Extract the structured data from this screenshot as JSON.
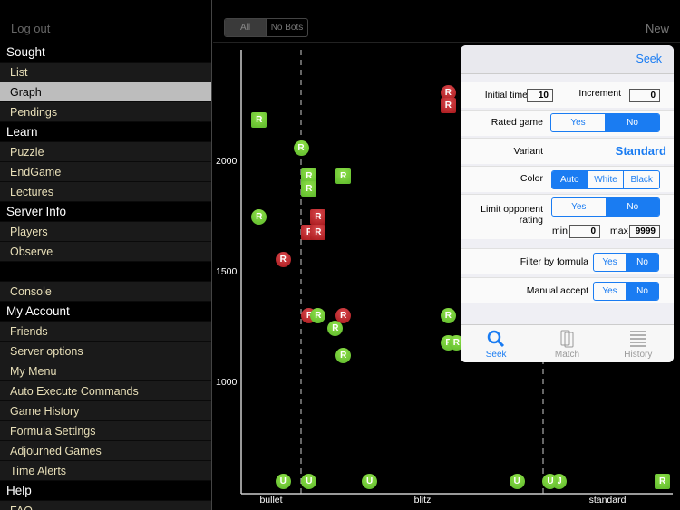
{
  "sidebar": {
    "logout": "Log out",
    "rows": [
      {
        "label": "Sought",
        "type": "header"
      },
      {
        "label": "List",
        "type": "item"
      },
      {
        "label": "Graph",
        "type": "item",
        "selected": true
      },
      {
        "label": "Pendings",
        "type": "item"
      },
      {
        "label": "Learn",
        "type": "header"
      },
      {
        "label": "Puzzle",
        "type": "item"
      },
      {
        "label": "EndGame",
        "type": "item"
      },
      {
        "label": "Lectures",
        "type": "item"
      },
      {
        "label": "Server Info",
        "type": "header"
      },
      {
        "label": "Players",
        "type": "item"
      },
      {
        "label": "Observe",
        "type": "item"
      },
      {
        "label": "",
        "type": "blank"
      },
      {
        "label": "Console",
        "type": "item"
      },
      {
        "label": "My Account",
        "type": "header"
      },
      {
        "label": "Friends",
        "type": "item"
      },
      {
        "label": "Server options",
        "type": "item"
      },
      {
        "label": "My Menu",
        "type": "item"
      },
      {
        "label": "Auto Execute Commands",
        "type": "item"
      },
      {
        "label": "Game History",
        "type": "item"
      },
      {
        "label": "Formula Settings",
        "type": "item"
      },
      {
        "label": "Adjourned Games",
        "type": "item"
      },
      {
        "label": "Time Alerts",
        "type": "item"
      },
      {
        "label": "Help",
        "type": "header"
      },
      {
        "label": "FAQ",
        "type": "item"
      }
    ]
  },
  "topbar": {
    "filter_all": "All",
    "filter_nobots": "No Bots",
    "selected": "All",
    "new_label": "New"
  },
  "chart_data": {
    "type": "scatter",
    "y_ticks": [
      1000,
      1500,
      2000
    ],
    "x_categories": [
      "bullet",
      "blitz",
      "standard"
    ],
    "category_boundaries_minutes": [
      3,
      15
    ],
    "colors": {
      "green": "#5cb82a",
      "red": "#a8181c"
    },
    "points": [
      {
        "minutes": 0.9,
        "rating": 2184,
        "shape": "square",
        "color": "green",
        "letter": "R"
      },
      {
        "minutes": 3.0,
        "rating": 2057,
        "shape": "circle",
        "color": "green",
        "letter": "R"
      },
      {
        "minutes": 3.4,
        "rating": 1930,
        "shape": "square",
        "color": "green",
        "letter": "R"
      },
      {
        "minutes": 5.1,
        "rating": 1930,
        "shape": "square",
        "color": "green",
        "letter": "R"
      },
      {
        "minutes": 3.4,
        "rating": 1869,
        "shape": "square",
        "color": "green",
        "letter": "R"
      },
      {
        "minutes": 0.9,
        "rating": 1742,
        "shape": "circle",
        "color": "green",
        "letter": "R"
      },
      {
        "minutes": 3.4,
        "rating": 1676,
        "shape": "square",
        "color": "red",
        "letter": "F"
      },
      {
        "minutes": 3.85,
        "rating": 1742,
        "shape": "square",
        "color": "red",
        "letter": "R"
      },
      {
        "minutes": 3.85,
        "rating": 1676,
        "shape": "square",
        "color": "red",
        "letter": "R"
      },
      {
        "minutes": 2.1,
        "rating": 1553,
        "shape": "circle",
        "color": "red",
        "letter": "R"
      },
      {
        "minutes": 3.4,
        "rating": 1299,
        "shape": "circle",
        "color": "red",
        "letter": "F"
      },
      {
        "minutes": 3.85,
        "rating": 1299,
        "shape": "circle",
        "color": "green",
        "letter": "R"
      },
      {
        "minutes": 5.1,
        "rating": 1299,
        "shape": "circle",
        "color": "red",
        "letter": "R"
      },
      {
        "minutes": 4.7,
        "rating": 1238,
        "shape": "circle",
        "color": "green",
        "letter": "R"
      },
      {
        "minutes": 5.1,
        "rating": 1115,
        "shape": "circle",
        "color": "green",
        "letter": "R"
      },
      {
        "minutes": 10.3,
        "rating": 2307,
        "shape": "circle",
        "color": "red",
        "letter": "R"
      },
      {
        "minutes": 10.3,
        "rating": 2246,
        "shape": "square",
        "color": "red",
        "letter": "R"
      },
      {
        "minutes": 10.3,
        "rating": 1299,
        "shape": "circle",
        "color": "green",
        "letter": "R"
      },
      {
        "minutes": 10.3,
        "rating": 1176,
        "shape": "circle",
        "color": "green",
        "letter": "F"
      },
      {
        "minutes": 10.7,
        "rating": 1176,
        "shape": "circle",
        "color": "green",
        "letter": "R"
      },
      {
        "minutes": 2.1,
        "rating": null,
        "shape": "circle",
        "color": "green",
        "letter": "U"
      },
      {
        "minutes": 3.4,
        "rating": null,
        "shape": "circle",
        "color": "green",
        "letter": "U"
      },
      {
        "minutes": 6.4,
        "rating": null,
        "shape": "circle",
        "color": "green",
        "letter": "U"
      },
      {
        "minutes": 13.7,
        "rating": null,
        "shape": "circle",
        "color": "green",
        "letter": "U"
      },
      {
        "minutes": 18.8,
        "rating": null,
        "shape": "circle",
        "color": "green",
        "letter": "J"
      },
      {
        "minutes": 16.7,
        "rating": null,
        "shape": "circle",
        "color": "green",
        "letter": "U"
      },
      {
        "minutes": 43,
        "rating": null,
        "shape": "square",
        "color": "green",
        "letter": "R"
      }
    ]
  },
  "seek": {
    "title": "Seek",
    "initial_time_label": "Initial time",
    "initial_time": "10",
    "increment_label": "Increment",
    "increment": "0",
    "rated_label": "Rated game",
    "rated_options": [
      "Yes",
      "No"
    ],
    "rated": "No",
    "variant_label": "Variant",
    "variant": "Standard",
    "color_label": "Color",
    "color_options": [
      "Auto",
      "White",
      "Black"
    ],
    "color": "Auto",
    "limit_label": "Limit opponent rating",
    "limit_options": [
      "Yes",
      "No"
    ],
    "limit": "No",
    "min_label": "min",
    "min": "0",
    "max_label": "max",
    "max": "9999",
    "formula_label": "Filter by formula",
    "formula_options": [
      "Yes",
      "No"
    ],
    "formula": "No",
    "manual_label": "Manual accept",
    "manual_options": [
      "Yes",
      "No"
    ],
    "manual": "No",
    "tabs": [
      {
        "label": "Seek",
        "icon": "search-icon",
        "active": true
      },
      {
        "label": "Match",
        "icon": "match-icon"
      },
      {
        "label": "History",
        "icon": "history-icon"
      }
    ]
  }
}
